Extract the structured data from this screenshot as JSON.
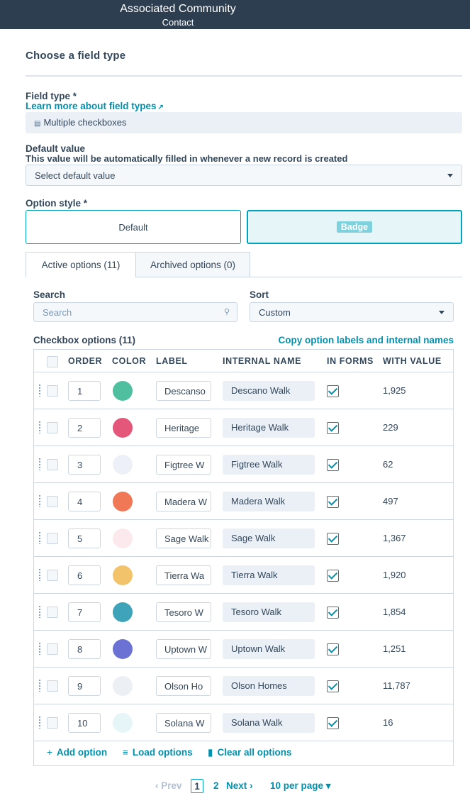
{
  "header": {
    "title": "Associated Community",
    "subtitle": "Contact"
  },
  "section": {
    "title": "Choose a field type"
  },
  "field_type": {
    "label": "Field type *",
    "learn_more": "Learn more about field types",
    "value": "Multiple checkboxes"
  },
  "default_value": {
    "label": "Default value",
    "help": "This value will be automatically filled in whenever a new record is created",
    "placeholder": "Select default value"
  },
  "option_style": {
    "label": "Option style *",
    "default_label": "Default",
    "badge_label": "Badge",
    "selected": "Badge"
  },
  "tabs": [
    {
      "label": "Active options (11)",
      "active": true
    },
    {
      "label": "Archived options (0)",
      "active": false
    }
  ],
  "search": {
    "label": "Search",
    "placeholder": "Search"
  },
  "sort": {
    "label": "Sort",
    "value": "Custom"
  },
  "checkbox_options": {
    "title": "Checkbox options (11)",
    "copy_link": "Copy option labels and internal names"
  },
  "table": {
    "headers": [
      "ORDER",
      "COLOR",
      "LABEL",
      "INTERNAL NAME",
      "IN FORMS",
      "WITH VALUE"
    ],
    "rows": [
      {
        "order": "1",
        "color": "#4fbf9f",
        "label": "Descanso",
        "internal": "Descano Walk",
        "in_forms": true,
        "with_value": "1,925"
      },
      {
        "order": "2",
        "color": "#e5577a",
        "label": "Heritage",
        "internal": "Heritage Walk",
        "in_forms": true,
        "with_value": "229"
      },
      {
        "order": "3",
        "color": "#eef0f8",
        "label": "Figtree W",
        "internal": "Figtree Walk",
        "in_forms": true,
        "with_value": "62"
      },
      {
        "order": "4",
        "color": "#f07857",
        "label": "Madera W",
        "internal": "Madera Walk",
        "in_forms": true,
        "with_value": "497"
      },
      {
        "order": "5",
        "color": "#fce9ee",
        "label": "Sage Walk",
        "internal": "Sage Walk",
        "in_forms": true,
        "with_value": "1,367"
      },
      {
        "order": "6",
        "color": "#f2c36b",
        "label": "Tierra Wa",
        "internal": "Tierra Walk",
        "in_forms": true,
        "with_value": "1,920"
      },
      {
        "order": "7",
        "color": "#3fa3b9",
        "label": "Tesoro W",
        "internal": "Tesoro Walk",
        "in_forms": true,
        "with_value": "1,854"
      },
      {
        "order": "8",
        "color": "#6c72d3",
        "label": "Uptown W",
        "internal": "Uptown Walk",
        "in_forms": true,
        "with_value": "1,251"
      },
      {
        "order": "9",
        "color": "#eceff3",
        "label": "Olson Ho",
        "internal": "Olson Homes",
        "in_forms": true,
        "with_value": "11,787"
      },
      {
        "order": "10",
        "color": "#e6f5f7",
        "label": "Solana W",
        "internal": "Solana Walk",
        "in_forms": true,
        "with_value": "16"
      }
    ]
  },
  "actions": {
    "add": "Add option",
    "load": "Load options",
    "clear": "Clear all options"
  },
  "pagination": {
    "prev": "Prev",
    "current": "1",
    "next_page": "2",
    "next": "Next",
    "per_page": "10 per page"
  }
}
